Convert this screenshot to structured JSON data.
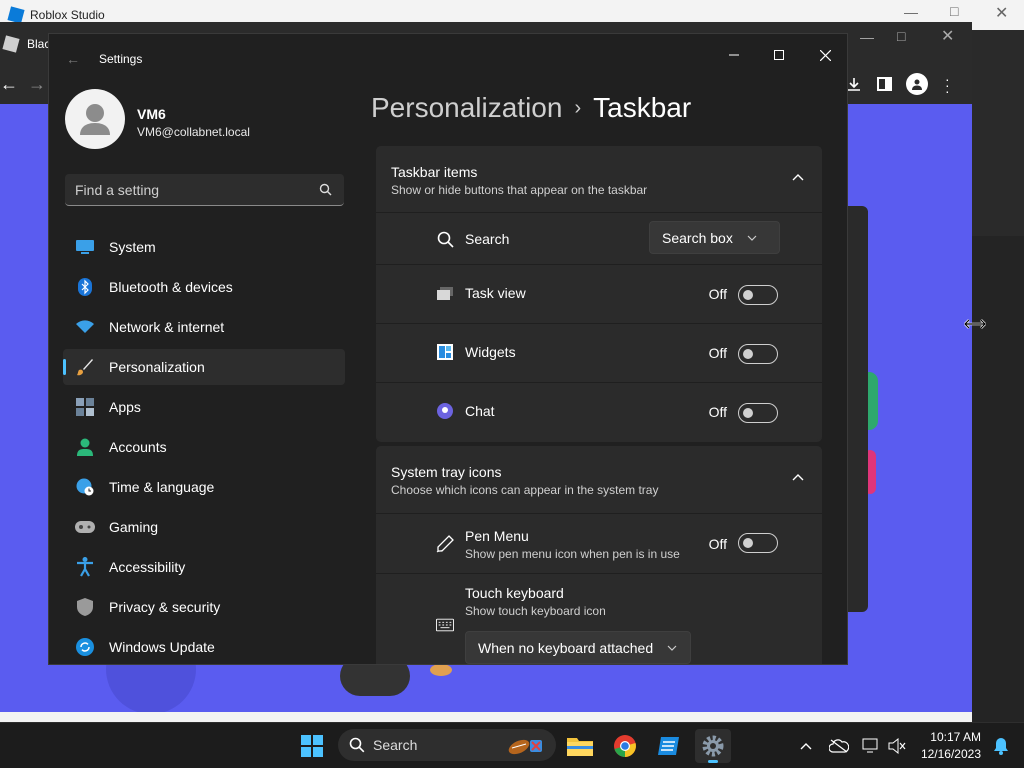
{
  "studio": {
    "title": "Roblox Studio"
  },
  "browser": {
    "tab_title": "Blac"
  },
  "settings": {
    "window_title": "Settings",
    "user": {
      "name": "VM6",
      "email": "VM6@collabnet.local"
    },
    "search_placeholder": "Find a setting",
    "nav": [
      {
        "label": "System",
        "icon": "system-icon"
      },
      {
        "label": "Bluetooth & devices",
        "icon": "bluetooth-icon"
      },
      {
        "label": "Network & internet",
        "icon": "wifi-icon"
      },
      {
        "label": "Personalization",
        "icon": "brush-icon",
        "selected": true
      },
      {
        "label": "Apps",
        "icon": "apps-icon"
      },
      {
        "label": "Accounts",
        "icon": "account-icon"
      },
      {
        "label": "Time & language",
        "icon": "globe-clock-icon"
      },
      {
        "label": "Gaming",
        "icon": "gamepad-icon"
      },
      {
        "label": "Accessibility",
        "icon": "accessibility-icon"
      },
      {
        "label": "Privacy & security",
        "icon": "shield-icon"
      },
      {
        "label": "Windows Update",
        "icon": "update-icon"
      }
    ],
    "breadcrumb": {
      "parent": "Personalization",
      "current": "Taskbar"
    },
    "taskbar_items": {
      "title": "Taskbar items",
      "subtitle": "Show or hide buttons that appear on the taskbar",
      "search": {
        "label": "Search",
        "value": "Search box"
      },
      "task_view": {
        "label": "Task view",
        "state": "Off"
      },
      "widgets": {
        "label": "Widgets",
        "state": "Off"
      },
      "chat": {
        "label": "Chat",
        "state": "Off"
      }
    },
    "system_tray": {
      "title": "System tray icons",
      "subtitle": "Choose which icons can appear in the system tray",
      "pen_menu": {
        "label": "Pen Menu",
        "desc": "Show pen menu icon when pen is in use",
        "state": "Off"
      },
      "touch_keyboard": {
        "label": "Touch keyboard",
        "desc": "Show touch keyboard icon",
        "value": "When no keyboard attached"
      }
    }
  },
  "taskbar": {
    "search_label": "Search",
    "time": "10:17 AM",
    "date": "12/16/2023"
  },
  "colors": {
    "accent": "#4cc2ff",
    "browser_bg": "#5a5cf0"
  }
}
